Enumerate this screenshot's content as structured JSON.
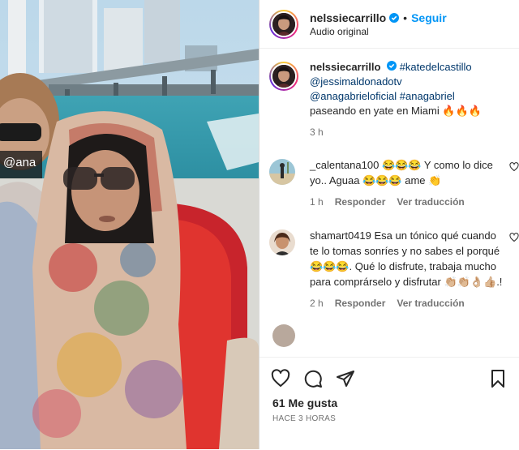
{
  "header": {
    "username": "nelssiecarrillo",
    "follow_label": "Seguir",
    "audio": "Audio original"
  },
  "media": {
    "overlay_text": "@ana"
  },
  "caption": {
    "username": "nelssiecarrillo",
    "tag1": "#katedelcastillo",
    "tag2": "@jessimaldonadotv",
    "tag3": "@anagabrieloficial",
    "tag4": "#anagabriel",
    "text": "paseando en yate en Miami 🔥🔥🔥",
    "time": "3 h"
  },
  "comments": [
    {
      "username": "_calentana100",
      "text": "😂😂😂 Y como lo dice yo.. Aguaa 😂😂😂 ame 👏",
      "time": "1 h",
      "reply": "Responder",
      "translate": "Ver traducción"
    },
    {
      "username": "shamart0419",
      "text": "Esa un tónico qué cuando te lo tomas sonríes y no sabes el porqué 😂😂😂. Qué lo disfrute, trabaja mucho para comprárselo y disfrutar 👏🏼👏🏼👌🏼👍🏼.!",
      "time": "2 h",
      "reply": "Responder",
      "translate": "Ver traducción"
    }
  ],
  "footer": {
    "likes": "61 Me gusta",
    "ago": "HACE 3 HORAS"
  },
  "colors": {
    "accent": "#0095f6",
    "link": "#00376b",
    "muted": "#737373"
  }
}
